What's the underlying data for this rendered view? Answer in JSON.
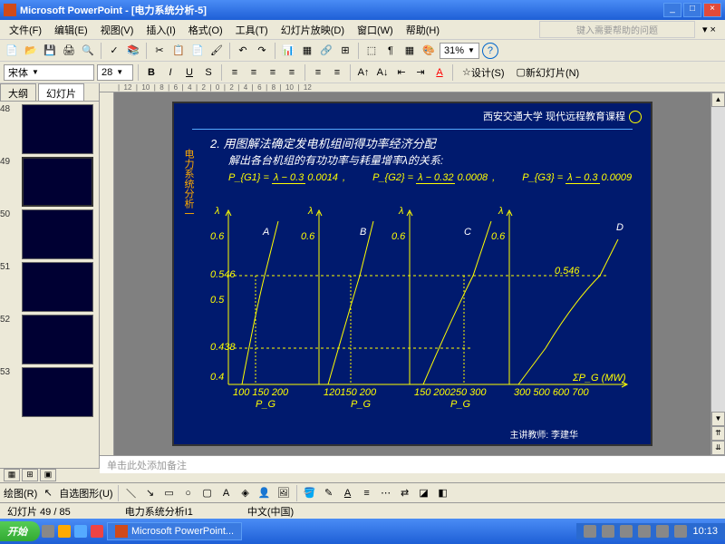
{
  "title": "Microsoft PowerPoint - [电力系统分析-5]",
  "menu": {
    "file": "文件(F)",
    "edit": "编辑(E)",
    "view": "视图(V)",
    "insert": "插入(I)",
    "format": "格式(O)",
    "tools": "工具(T)",
    "slideshow": "幻灯片放映(D)",
    "window": "窗口(W)",
    "help": "帮助(H)",
    "helpbox": "键入需要帮助的问题"
  },
  "zoom": "31%",
  "font": {
    "name": "宋体",
    "size": "28",
    "design": "设计(S)",
    "newslide": "新幻灯片(N)"
  },
  "tabs": {
    "outline": "大纲",
    "slides": "幻灯片"
  },
  "thumbs": [
    "48",
    "49",
    "50",
    "51",
    "52",
    "53"
  ],
  "slide": {
    "uni": "西安交通大学 现代远程教育课程",
    "side": "电力系统分析一",
    "title": "2. 用图解法确定发电机组间得功率经济分配",
    "sub": "解出各台机组的有功功率与耗量增率λ的关系:",
    "eq": {
      "p1": "P_{G1} =",
      "n1": "λ − 0.3",
      "d1": "0.0014",
      "p2": "P_{G2} =",
      "n2": "λ − 0.32",
      "d2": "0.0008",
      "p3": "P_{G3} =",
      "n3": "λ − 0.3",
      "d3": "0.0009"
    },
    "foot": "主讲教师:    李建华"
  },
  "chart_data": {
    "type": "line",
    "title": "",
    "xlabel": "ΣP_G (MW)",
    "ylabel": "λ",
    "panels": [
      "A",
      "B",
      "C",
      "D"
    ],
    "y_ticks": [
      0.4,
      0.438,
      0.5,
      0.546,
      0.6
    ],
    "x_ticks_A": [
      100,
      150,
      200
    ],
    "x_ticks_B": [
      120,
      150,
      200
    ],
    "x_ticks_C": [
      150,
      200,
      250,
      300
    ],
    "x_ticks_D": [
      300,
      500,
      600,
      700
    ],
    "hlines": [
      0.438,
      0.546
    ],
    "note": "Four vertical λ-vs-P_G subplots sharing y-axis; each shows a steep near-linear curve; dashed horizontals at λ=0.438 and λ=0.546 intersect curves to read off P_G values"
  },
  "notes": "单击此处添加备注",
  "draw": {
    "label": "绘图(R)",
    "autoshape": "自选图形(U)"
  },
  "status": {
    "slide": "幻灯片 49 / 85",
    "title": "电力系统分析I1",
    "lang": "中文(中国)"
  },
  "taskbar": {
    "start": "开始",
    "app": "Microsoft PowerPoint...",
    "time": "10:13"
  }
}
